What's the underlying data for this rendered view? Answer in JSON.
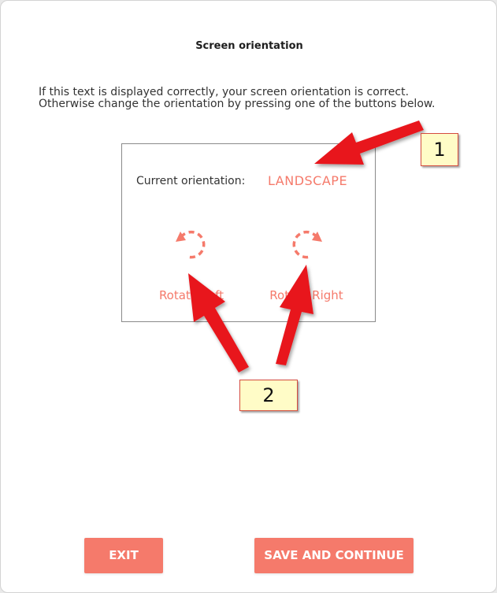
{
  "dialog": {
    "title": "Screen orientation",
    "instructions_line1": "If this text is displayed correctly, your screen orientation is correct.",
    "instructions_line2": "Otherwise change the orientation by pressing one of the buttons below."
  },
  "orientation": {
    "current_label": "Current orientation:",
    "current_value": "LANDSCAPE",
    "rotate_left_label": "Rotate Left",
    "rotate_right_label": "Rotate Right",
    "rotate_left_icon": "rotate-counterclockwise-icon",
    "rotate_right_icon": "rotate-clockwise-icon"
  },
  "annotations": {
    "callout_1": "1",
    "callout_2": "2"
  },
  "footer": {
    "exit_label": "EXIT",
    "save_label": "SAVE AND CONTINUE"
  },
  "colors": {
    "accent": "#f57a6b",
    "annotation_arrow": "#e8191f",
    "callout_fill": "#fffcc7",
    "callout_border": "#d44b3f"
  }
}
